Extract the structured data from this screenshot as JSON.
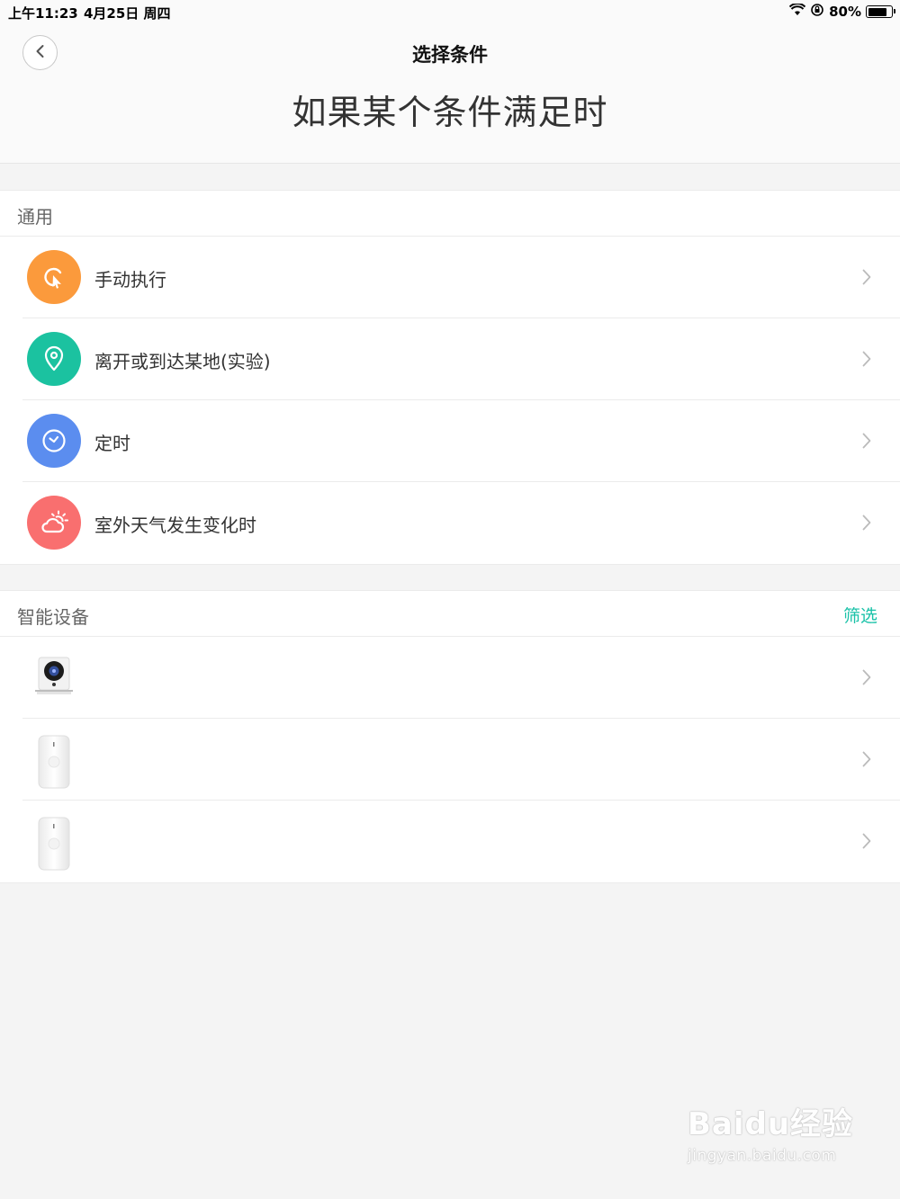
{
  "status_bar": {
    "time": "上午11:23",
    "date": "4月25日 周四",
    "battery": "80%",
    "battery_level": 0.8
  },
  "header": {
    "nav_title": "选择条件",
    "page_title": "如果某个条件满足时"
  },
  "general": {
    "title": "通用",
    "items": [
      {
        "label": "手动执行",
        "icon": "manual-click-icon",
        "color": "#fb9a3c"
      },
      {
        "label": "离开或到达某地(实验)",
        "icon": "location-pin-icon",
        "color": "#1bc2a0"
      },
      {
        "label": "定时",
        "icon": "clock-icon",
        "color": "#5b8def"
      },
      {
        "label": "室外天气发生变化时",
        "icon": "weather-icon",
        "color": "#f96f6f"
      }
    ]
  },
  "devices": {
    "title": "智能设备",
    "filter_label": "筛选",
    "items": [
      {
        "icon": "camera-device-icon"
      },
      {
        "icon": "sensor-device-icon"
      },
      {
        "icon": "sensor-device-icon"
      }
    ]
  },
  "watermark": {
    "main": "Baidu经验",
    "sub": "jingyan.baidu.com"
  }
}
